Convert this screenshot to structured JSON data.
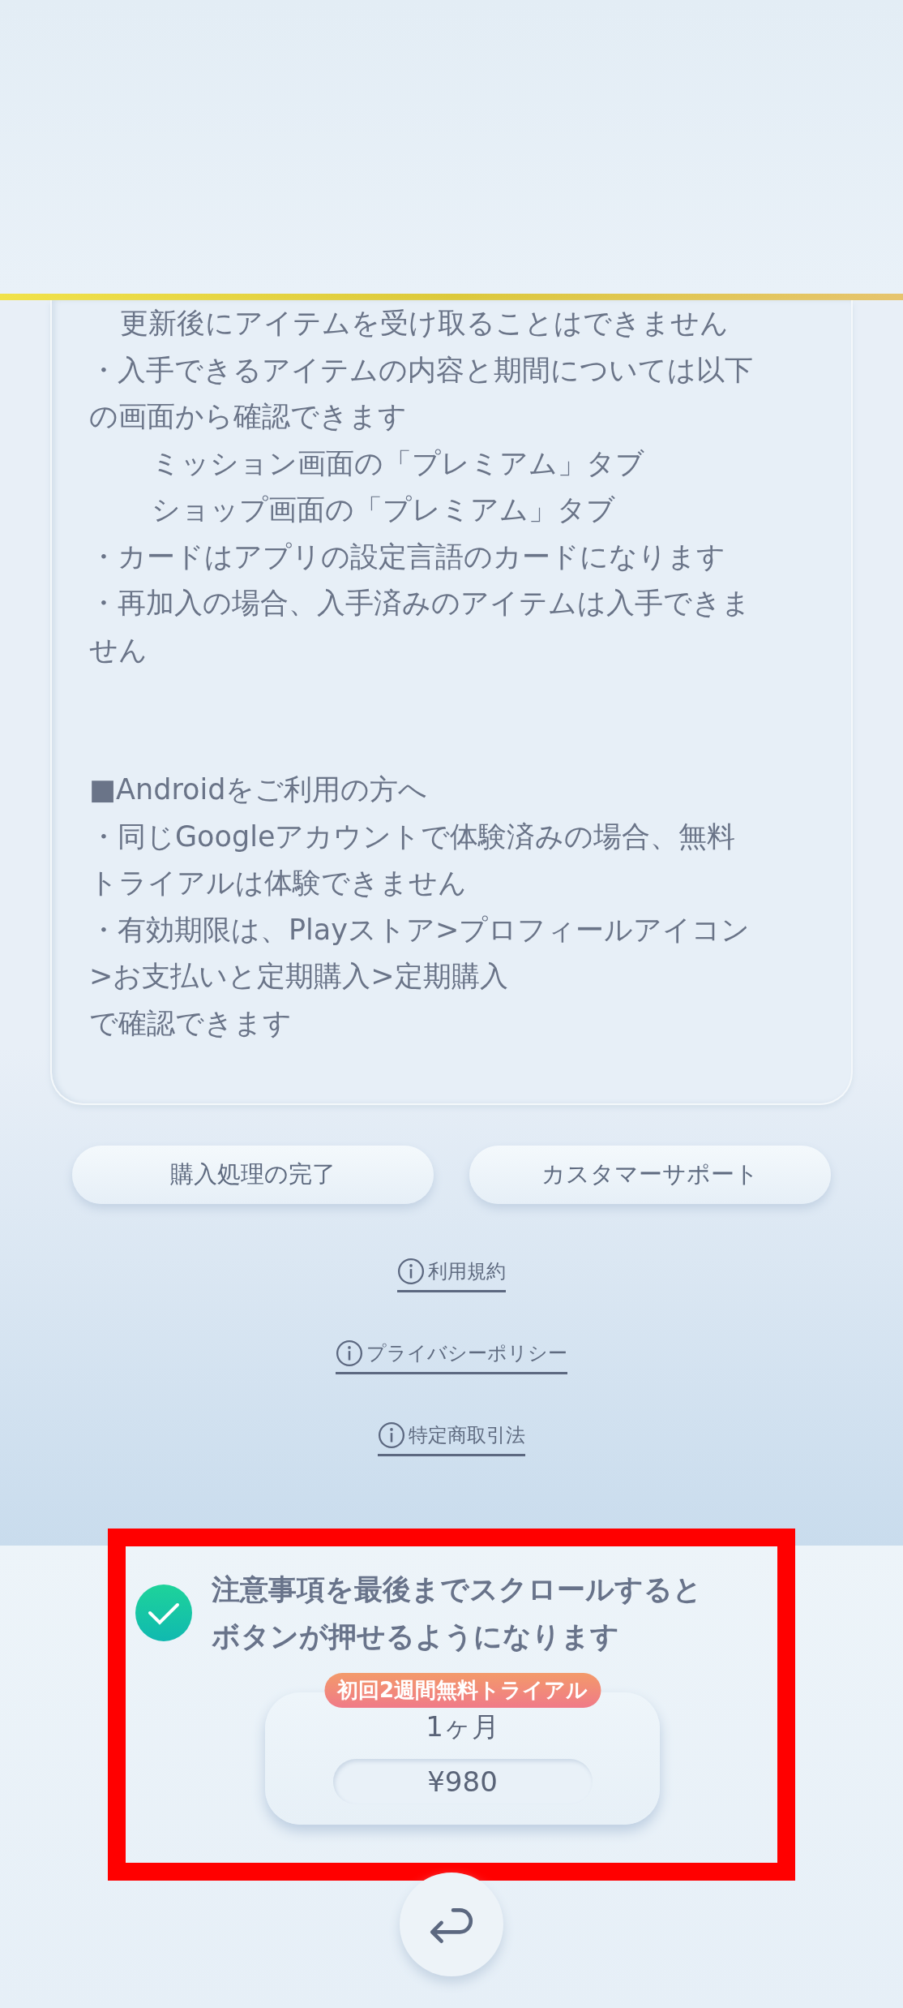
{
  "notes": {
    "paragraphs": [
      {
        "kind": "continuation",
        "text": "更新後にアイテムを受け取ることはできません"
      },
      {
        "kind": "text",
        "text": "・入手できるアイテムの内容と期間については以下"
      },
      {
        "kind": "text",
        "text": "の画面から確認できます"
      },
      {
        "kind": "sub",
        "text": "ミッション画面の「プレミアム」タブ"
      },
      {
        "kind": "sub",
        "text": "ショップ画面の「プレミアム」タブ"
      },
      {
        "kind": "text",
        "text": "・カードはアプリの設定言語のカードになります"
      },
      {
        "kind": "text",
        "text": "・再加入の場合、入手済みのアイテムは入手できま"
      },
      {
        "kind": "text",
        "text": "せん"
      },
      {
        "kind": "heading",
        "text": "■Androidをご利用の方へ"
      },
      {
        "kind": "text",
        "text": "・同じGoogleアカウントで体験済みの場合、無料"
      },
      {
        "kind": "text",
        "text": "トライアルは体験できません"
      },
      {
        "kind": "text",
        "text": "・有効期限は、Playストア>プロフィールアイコン"
      },
      {
        "kind": "text",
        "text": ">お支払いと定期購入>定期購入"
      },
      {
        "kind": "text",
        "text": "で確認できます"
      }
    ]
  },
  "buttons": [
    "購入処理の完了",
    "カスタマーサポート"
  ],
  "links": [
    "利用規約",
    "プライバシーポリシー",
    "特定商取引法"
  ],
  "notice": {
    "checked": true,
    "lines": [
      "注意事項を最後までスクロールすると",
      "ボタンが押せるようになります"
    ]
  },
  "plan": {
    "badge": "初回2週間無料トライアル",
    "name": "1ヶ月",
    "price": "¥980"
  }
}
